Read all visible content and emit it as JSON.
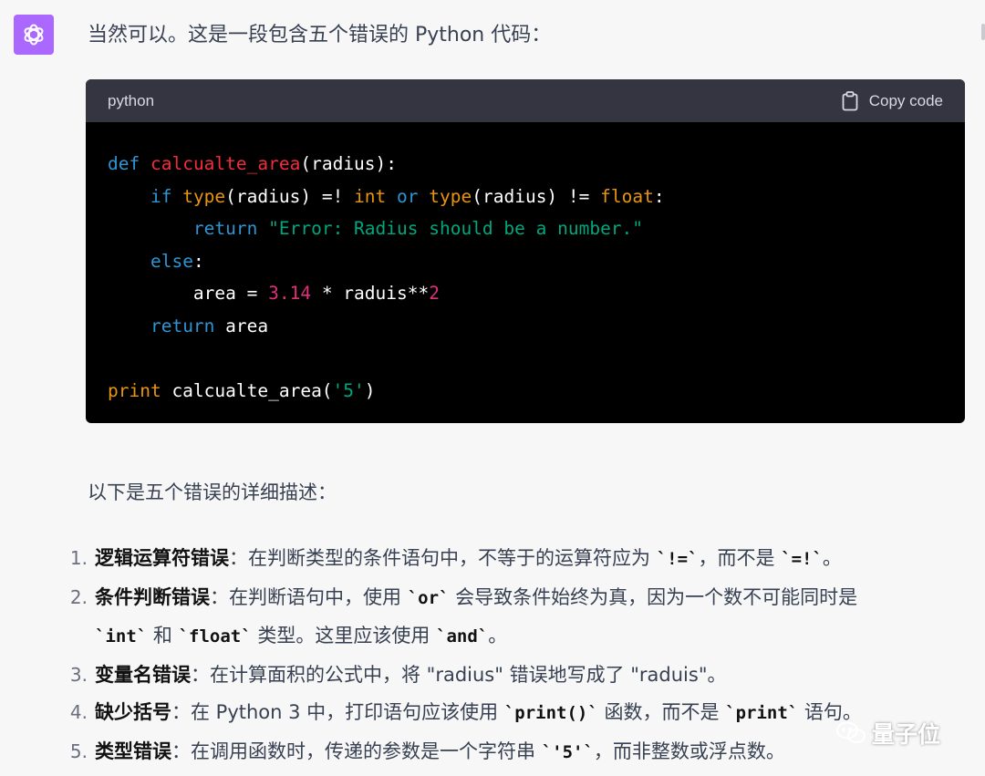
{
  "message": {
    "intro": "当然可以。这是一段包含五个错误的 Python 代码：",
    "section_title": "以下是五个错误的详细描述："
  },
  "code_block": {
    "language": "python",
    "copy_label": "Copy code"
  },
  "code_tokens": {
    "def": "def",
    "fn_name": "calcualte_area",
    "sig_args": "(radius):",
    "if": "if",
    "type": "type",
    "paren_radius": "(radius)",
    "bad_op": " =! ",
    "int": "int",
    "or": "or",
    "ne_op": " != ",
    "float": "float",
    "colon": ":",
    "return": "return",
    "err_str": "\"Error: Radius should be a number.\"",
    "else": "else",
    "area_assign": "area = ",
    "num_314": "3.14",
    "mul_raduis": " * raduis**",
    "num_2": "2",
    "area": " area",
    "print": "print",
    "call_open": " calcualte_area(",
    "arg_str": "'5'",
    "call_close": ")"
  },
  "errors": [
    {
      "n": "1.",
      "title": "逻辑运算符错误",
      "t1": "：在判断类型的条件语句中，不等于的运算符应为 ",
      "c1": "`!=`",
      "t2": "，而不是 ",
      "c2": "`=!`",
      "t3": "。"
    },
    {
      "n": "2.",
      "title": "条件判断错误",
      "t1": "：在判断语句中，使用 ",
      "c1": "`or`",
      "t2": " 会导致条件始终为真，因为一个数不可能同时是",
      "c2": "`int`",
      "t3": " 和 ",
      "c3": "`float`",
      "t4": " 类型。这里应该使用 ",
      "c4": "`and`",
      "t5": "。"
    },
    {
      "n": "3.",
      "title": "变量名错误",
      "t1": "：在计算面积的公式中，将 \"radius\" 错误地写成了 \"raduis\"。"
    },
    {
      "n": "4.",
      "title": "缺少括号",
      "t1": "：在 Python 3 中，打印语句应该使用 ",
      "c1": "`print()`",
      "t2": " 函数，而不是 ",
      "c2": "`print`",
      "t3": " 语句。"
    },
    {
      "n": "5.",
      "title": "类型错误",
      "t1": "：在调用函数时，传递的参数是一个字符串 ",
      "c1": "`'5'`",
      "t2": "，而非整数或浮点数。"
    }
  ],
  "watermark": {
    "text": "量子位"
  },
  "icons": {
    "avatar": "openai-logo-icon",
    "copy": "clipboard-icon",
    "watermark": "wechat-icon"
  },
  "colors": {
    "avatar_bg": "#ab68ff",
    "code_bg": "#000000",
    "code_header_bg": "#343541",
    "keyword": "#2e95d3",
    "function": "#f22c3d",
    "builtin": "#e9950c",
    "string": "#00a67d",
    "number": "#df3079"
  }
}
